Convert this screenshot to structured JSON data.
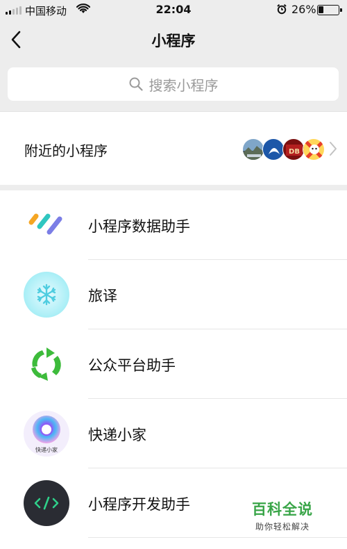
{
  "status_bar": {
    "carrier": "中国移动",
    "time": "22:04",
    "battery_percent_text": "26%",
    "battery_level": 0.26,
    "signal_bars_filled": 2
  },
  "nav": {
    "title": "小程序",
    "back_icon": "chevron-left-icon"
  },
  "search": {
    "placeholder": "搜索小程序",
    "icon": "search-icon"
  },
  "nearby": {
    "label": "附近的小程序",
    "thumbnails": [
      "landscape-thumb",
      "bank-logo-thumb",
      "red-brand-thumb",
      "cartoon-thumb"
    ]
  },
  "mini_programs": [
    {
      "name": "小程序数据助手",
      "icon": "data-assistant-icon"
    },
    {
      "name": "旅译",
      "icon": "snowflake-icon"
    },
    {
      "name": "公众平台助手",
      "icon": "recycle-arrows-icon"
    },
    {
      "name": "快递小家",
      "icon": "express-home-icon",
      "icon_caption": "快递小家"
    },
    {
      "name": "小程序开发助手",
      "icon": "code-brackets-icon"
    }
  ],
  "watermark": {
    "title": "百科全说",
    "subtitle": "助你轻松解决"
  },
  "colors": {
    "background": "#ededed",
    "card": "#ffffff",
    "watermark_green": "#39a548",
    "placeholder_gray": "#9a9a9a"
  }
}
